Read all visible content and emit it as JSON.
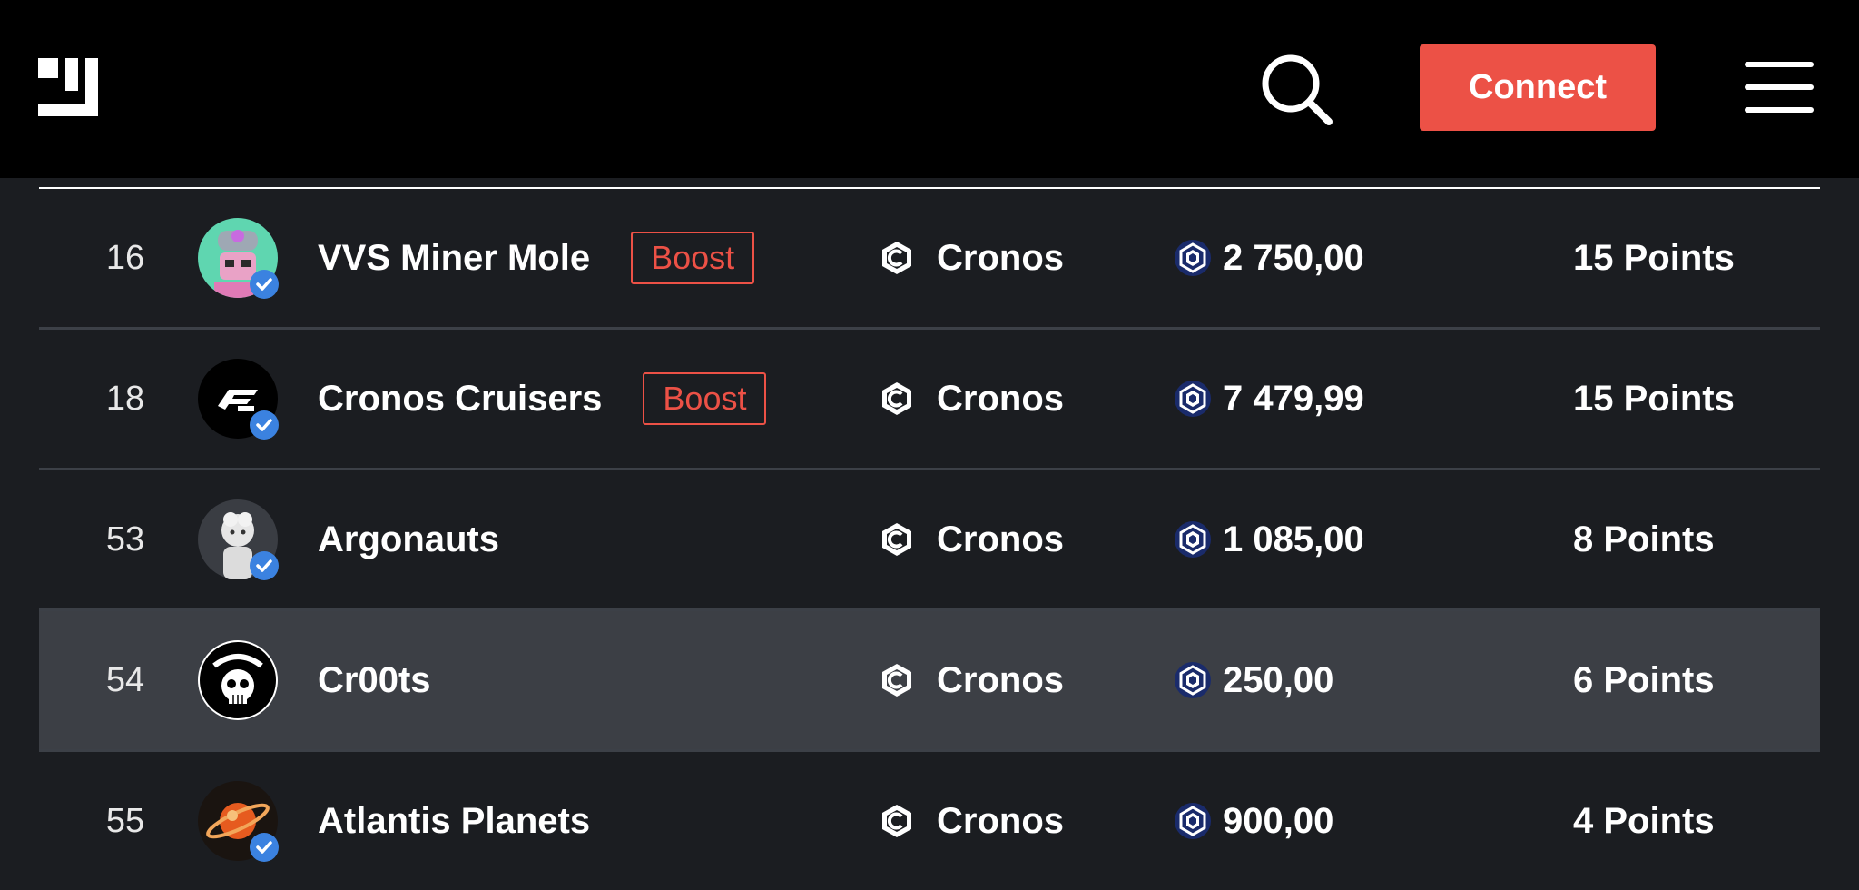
{
  "header": {
    "connect_label": "Connect"
  },
  "icons": {
    "logo": "brand-logo",
    "search": "search-icon",
    "menu": "hamburger-menu-icon",
    "chain": "cronos-chain-icon",
    "currency": "cro-token-icon",
    "verified": "verified-badge-icon"
  },
  "colors": {
    "accent": "#ec5146",
    "background": "#1b1d21",
    "header": "#000000",
    "highlight_row": "#3c3f45",
    "verified": "#3b82e0"
  },
  "rows": [
    {
      "rank": "16",
      "name": "VVS Miner Mole",
      "boost": "Boost",
      "chain": "Cronos",
      "price": "2 750,00",
      "points": "15 Points"
    },
    {
      "rank": "18",
      "name": "Cronos Cruisers",
      "boost": "Boost",
      "chain": "Cronos",
      "price": "7 479,99",
      "points": "15 Points"
    },
    {
      "rank": "53",
      "name": "Argonauts",
      "chain": "Cronos",
      "price": "1 085,00",
      "points": "8 Points"
    },
    {
      "rank": "54",
      "name": "Cr00ts",
      "chain": "Cronos",
      "price": "250,00",
      "points": "6 Points"
    },
    {
      "rank": "55",
      "name": "Atlantis Planets",
      "chain": "Cronos",
      "price": "900,00",
      "points": "4 Points"
    }
  ]
}
